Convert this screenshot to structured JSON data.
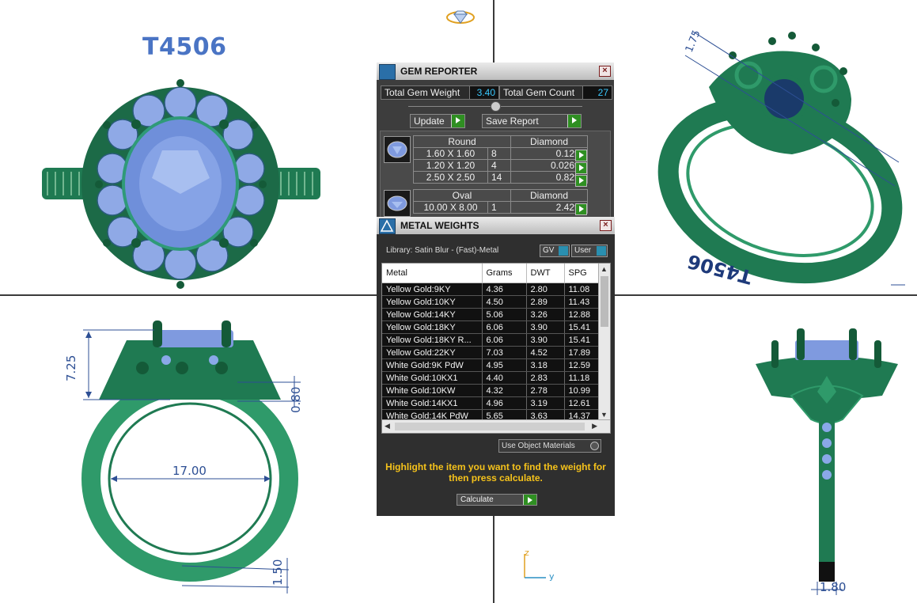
{
  "model": {
    "title": "T4506",
    "watermark": "T4506"
  },
  "dimensions": {
    "head_height": "7.25",
    "gallery": "0.80",
    "inner_diameter": "17.00",
    "shank_thickness": "1.50",
    "shank_width": "1.80",
    "tilted_a": "1.75"
  },
  "axes": {
    "z": "z",
    "y": "y"
  },
  "gem_reporter": {
    "title": "GEM REPORTER",
    "total_weight_label": "Total Gem Weight",
    "total_weight_value": "3.40",
    "total_count_label": "Total Gem Count",
    "total_count_value": "27",
    "update_label": "Update",
    "save_report_label": "Save Report",
    "groups": [
      {
        "shape": "Round",
        "material": "Diamond",
        "rows": [
          {
            "size": "1.60 X 1.60",
            "count": "8",
            "weight": "0.12tw"
          },
          {
            "size": "1.20 X 1.20",
            "count": "4",
            "weight": "0.026tw"
          },
          {
            "size": "2.50 X 2.50",
            "count": "14",
            "weight": "0.82tw"
          }
        ]
      },
      {
        "shape": "Oval",
        "material": "Diamond",
        "rows": [
          {
            "size": "10.00 X 8.00",
            "count": "1",
            "weight": "2.42tw"
          }
        ]
      }
    ]
  },
  "metal_weights": {
    "title": "METAL WEIGHTS",
    "library": "Library: Satin Blur - (Fast)-Metal",
    "gv_label": "GV",
    "user_label": "User",
    "columns": [
      "Metal",
      "Grams",
      "DWT",
      "SPG"
    ],
    "rows": [
      {
        "metal": "Yellow Gold:9KY",
        "grams": "4.36",
        "dwt": "2.80",
        "spg": "11.08"
      },
      {
        "metal": "Yellow Gold:10KY",
        "grams": "4.50",
        "dwt": "2.89",
        "spg": "11.43"
      },
      {
        "metal": "Yellow Gold:14KY",
        "grams": "5.06",
        "dwt": "3.26",
        "spg": "12.88"
      },
      {
        "metal": "Yellow Gold:18KY",
        "grams": "6.06",
        "dwt": "3.90",
        "spg": "15.41"
      },
      {
        "metal": "Yellow Gold:18KY R...",
        "grams": "6.06",
        "dwt": "3.90",
        "spg": "15.41"
      },
      {
        "metal": "Yellow Gold:22KY",
        "grams": "7.03",
        "dwt": "4.52",
        "spg": "17.89"
      },
      {
        "metal": "White Gold:9K PdW",
        "grams": "4.95",
        "dwt": "3.18",
        "spg": "12.59"
      },
      {
        "metal": "White Gold:10KX1",
        "grams": "4.40",
        "dwt": "2.83",
        "spg": "11.18"
      },
      {
        "metal": "White Gold:10KW",
        "grams": "4.32",
        "dwt": "2.78",
        "spg": "10.99"
      },
      {
        "metal": "White Gold:14KX1",
        "grams": "4.96",
        "dwt": "3.19",
        "spg": "12.61"
      },
      {
        "metal": "White Gold:14K PdW",
        "grams": "5.65",
        "dwt": "3.63",
        "spg": "14.37"
      }
    ],
    "use_object_materials_label": "Use Object Materials",
    "hint": "Highlight the item you want to find the weight for then press calculate.",
    "calculate_label": "Calculate"
  },
  "colors": {
    "metal": "#1f7a52",
    "gem": "#8aa8e8",
    "accent_blue": "#39c9ff",
    "hint_yellow": "#f5c21b",
    "go_green": "#2f8f22"
  }
}
